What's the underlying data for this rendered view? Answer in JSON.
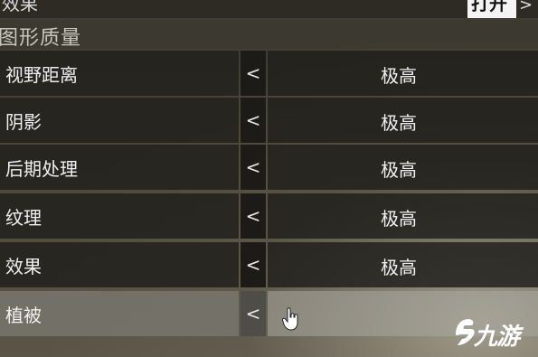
{
  "top": {
    "label": "效果",
    "toggle_value": "打开",
    "arrow": ">"
  },
  "section": {
    "title": "图形质量"
  },
  "settings": [
    {
      "label": "视野距离",
      "arrow": "<",
      "value": "极高"
    },
    {
      "label": "阴影",
      "arrow": "<",
      "value": "极高"
    },
    {
      "label": "后期处理",
      "arrow": "<",
      "value": "极高"
    },
    {
      "label": "纹理",
      "arrow": "<",
      "value": "极高"
    },
    {
      "label": "效果",
      "arrow": "<",
      "value": "极高"
    },
    {
      "label": "植被",
      "arrow": "<",
      "value": ""
    }
  ],
  "watermark": {
    "text": "九游"
  },
  "colors": {
    "row_bg": "#22211d",
    "arrow_bg": "#1c1b18",
    "selected_row": "#787670",
    "text": "#f0f0f0"
  },
  "icons": {
    "cursor": "hand-pointer-icon",
    "watermark_logo": "jiuyou-logo-icon"
  }
}
